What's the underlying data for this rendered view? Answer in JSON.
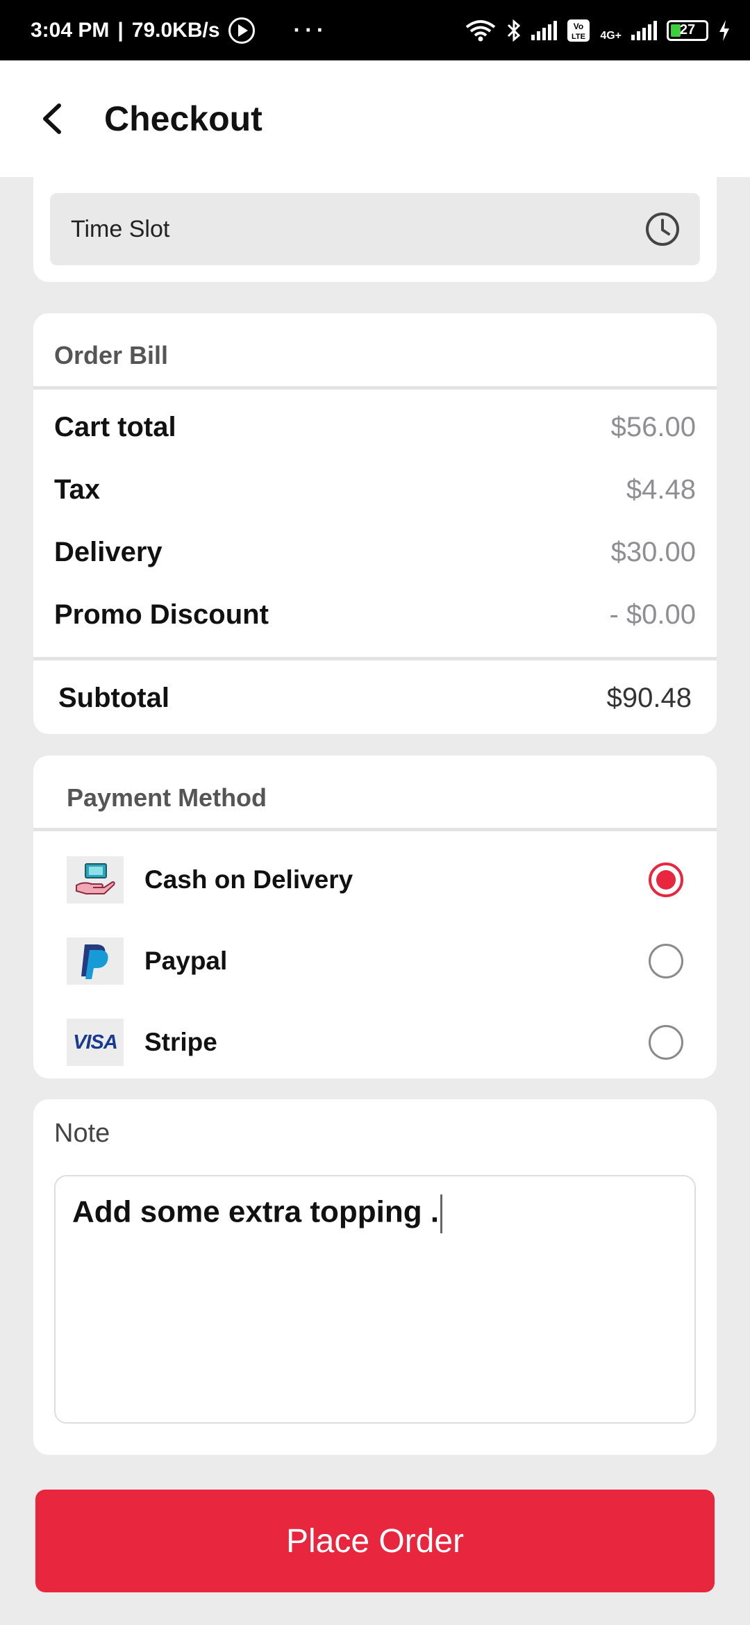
{
  "status_bar": {
    "time": "3:04 PM",
    "separator": "|",
    "speed": "79.0KB/s",
    "dots": "···",
    "volte": "Vo LTE",
    "network": "4G+",
    "battery": "27"
  },
  "header": {
    "title": "Checkout"
  },
  "time_slot": {
    "placeholder": "Time Slot"
  },
  "order_bill": {
    "title": "Order Bill",
    "rows": [
      {
        "label": "Cart total",
        "value": "$56.00"
      },
      {
        "label": "Tax",
        "value": "$4.48"
      },
      {
        "label": "Delivery",
        "value": "$30.00"
      },
      {
        "label": "Promo Discount",
        "value": "- $0.00"
      }
    ],
    "subtotal": {
      "label": "Subtotal",
      "value": "$90.48"
    }
  },
  "payment": {
    "title": "Payment Method",
    "methods": [
      {
        "label": "Cash on Delivery",
        "icon": "cash-hand-icon",
        "selected": true
      },
      {
        "label": "Paypal",
        "icon": "paypal-icon",
        "selected": false
      },
      {
        "label": "Stripe",
        "icon": "visa-icon",
        "selected": false
      }
    ],
    "visa_text": "VISA"
  },
  "note": {
    "title": "Note",
    "value": "Add some extra topping ."
  },
  "actions": {
    "place_order": "Place Order"
  },
  "colors": {
    "accent": "#e8273f",
    "background": "#ebebeb"
  }
}
